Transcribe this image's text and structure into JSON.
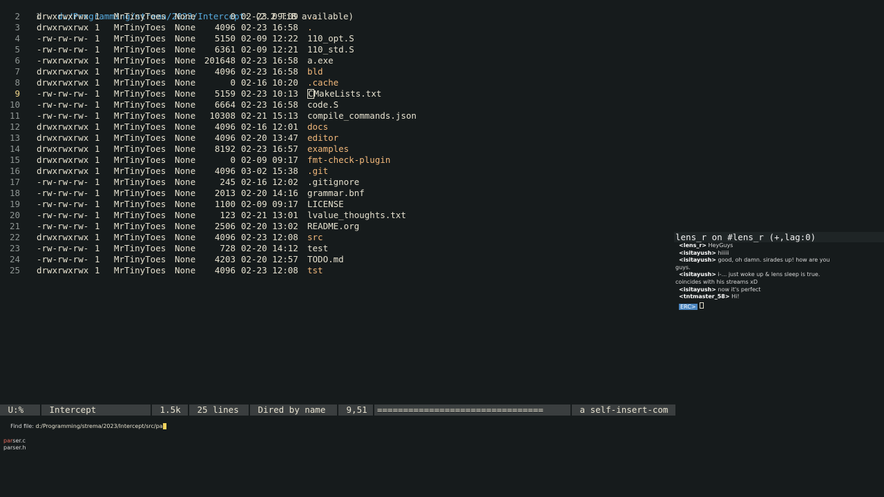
{
  "header_line": {
    "number": "1",
    "path": "d:/Programming/strema/2023/Intercept",
    "suffix": ": (2.2 TiB available)"
  },
  "entries": [
    {
      "n": "2",
      "perms": "drwxrwxrwx",
      "links": "1",
      "owner": "MrTinyToes",
      "group": "None",
      "size": "0",
      "date": "02-23",
      "time": "09:09",
      "name": "..",
      "dir": true
    },
    {
      "n": "3",
      "perms": "drwxrwxrwx",
      "links": "1",
      "owner": "MrTinyToes",
      "group": "None",
      "size": "4096",
      "date": "02-23",
      "time": "16:58",
      "name": ".",
      "dir": true
    },
    {
      "n": "4",
      "perms": "-rw-rw-rw-",
      "links": "1",
      "owner": "MrTinyToes",
      "group": "None",
      "size": "5150",
      "date": "02-09",
      "time": "12:22",
      "name": "110_opt.S",
      "dir": false
    },
    {
      "n": "5",
      "perms": "-rw-rw-rw-",
      "links": "1",
      "owner": "MrTinyToes",
      "group": "None",
      "size": "6361",
      "date": "02-09",
      "time": "12:21",
      "name": "110_std.S",
      "dir": false
    },
    {
      "n": "6",
      "perms": "-rwxrwxrwx",
      "links": "1",
      "owner": "MrTinyToes",
      "group": "None",
      "size": "201648",
      "date": "02-23",
      "time": "16:58",
      "name": "a.exe",
      "dir": false
    },
    {
      "n": "7",
      "perms": "drwxrwxrwx",
      "links": "1",
      "owner": "MrTinyToes",
      "group": "None",
      "size": "4096",
      "date": "02-23",
      "time": "16:58",
      "name": "bld",
      "dir": true
    },
    {
      "n": "8",
      "perms": "drwxrwxrwx",
      "links": "1",
      "owner": "MrTinyToes",
      "group": "None",
      "size": "0",
      "date": "02-16",
      "time": "10:20",
      "name": ".cache",
      "dir": true
    },
    {
      "n": "9",
      "perms": "-rw-rw-rw-",
      "links": "1",
      "owner": "MrTinyToes",
      "group": "None",
      "size": "5159",
      "date": "02-23",
      "time": "10:13",
      "name": "CMakeLists.txt",
      "dir": false,
      "current": true
    },
    {
      "n": "10",
      "perms": "-rw-rw-rw-",
      "links": "1",
      "owner": "MrTinyToes",
      "group": "None",
      "size": "6664",
      "date": "02-23",
      "time": "16:58",
      "name": "code.S",
      "dir": false
    },
    {
      "n": "11",
      "perms": "-rw-rw-rw-",
      "links": "1",
      "owner": "MrTinyToes",
      "group": "None",
      "size": "10308",
      "date": "02-21",
      "time": "15:13",
      "name": "compile_commands.json",
      "dir": false
    },
    {
      "n": "12",
      "perms": "drwxrwxrwx",
      "links": "1",
      "owner": "MrTinyToes",
      "group": "None",
      "size": "4096",
      "date": "02-16",
      "time": "12:01",
      "name": "docs",
      "dir": true
    },
    {
      "n": "13",
      "perms": "drwxrwxrwx",
      "links": "1",
      "owner": "MrTinyToes",
      "group": "None",
      "size": "4096",
      "date": "02-20",
      "time": "13:47",
      "name": "editor",
      "dir": true
    },
    {
      "n": "14",
      "perms": "drwxrwxrwx",
      "links": "1",
      "owner": "MrTinyToes",
      "group": "None",
      "size": "8192",
      "date": "02-23",
      "time": "16:57",
      "name": "examples",
      "dir": true
    },
    {
      "n": "15",
      "perms": "drwxrwxrwx",
      "links": "1",
      "owner": "MrTinyToes",
      "group": "None",
      "size": "0",
      "date": "02-09",
      "time": "09:17",
      "name": "fmt-check-plugin",
      "dir": true
    },
    {
      "n": "16",
      "perms": "drwxrwxrwx",
      "links": "1",
      "owner": "MrTinyToes",
      "group": "None",
      "size": "4096",
      "date": "03-02",
      "time": "15:38",
      "name": ".git",
      "dir": true
    },
    {
      "n": "17",
      "perms": "-rw-rw-rw-",
      "links": "1",
      "owner": "MrTinyToes",
      "group": "None",
      "size": "245",
      "date": "02-16",
      "time": "12:02",
      "name": ".gitignore",
      "dir": false
    },
    {
      "n": "18",
      "perms": "-rw-rw-rw-",
      "links": "1",
      "owner": "MrTinyToes",
      "group": "None",
      "size": "2013",
      "date": "02-20",
      "time": "14:16",
      "name": "grammar.bnf",
      "dir": false
    },
    {
      "n": "19",
      "perms": "-rw-rw-rw-",
      "links": "1",
      "owner": "MrTinyToes",
      "group": "None",
      "size": "1100",
      "date": "02-09",
      "time": "09:17",
      "name": "LICENSE",
      "dir": false
    },
    {
      "n": "20",
      "perms": "-rw-rw-rw-",
      "links": "1",
      "owner": "MrTinyToes",
      "group": "None",
      "size": "123",
      "date": "02-21",
      "time": "13:01",
      "name": "lvalue_thoughts.txt",
      "dir": false
    },
    {
      "n": "21",
      "perms": "-rw-rw-rw-",
      "links": "1",
      "owner": "MrTinyToes",
      "group": "None",
      "size": "2506",
      "date": "02-20",
      "time": "13:02",
      "name": "README.org",
      "dir": false
    },
    {
      "n": "22",
      "perms": "drwxrwxrwx",
      "links": "1",
      "owner": "MrTinyToes",
      "group": "None",
      "size": "4096",
      "date": "02-23",
      "time": "12:08",
      "name": "src",
      "dir": true
    },
    {
      "n": "23",
      "perms": "-rw-rw-rw-",
      "links": "1",
      "owner": "MrTinyToes",
      "group": "None",
      "size": "728",
      "date": "02-20",
      "time": "14:12",
      "name": "test",
      "dir": false
    },
    {
      "n": "24",
      "perms": "-rw-rw-rw-",
      "links": "1",
      "owner": "MrTinyToes",
      "group": "None",
      "size": "4203",
      "date": "02-20",
      "time": "12:57",
      "name": "TODO.md",
      "dir": false
    },
    {
      "n": "25",
      "perms": "drwxrwxrwx",
      "links": "1",
      "owner": "MrTinyToes",
      "group": "None",
      "size": "4096",
      "date": "02-23",
      "time": "12:08",
      "name": "tst",
      "dir": true
    }
  ],
  "irc": {
    "title": "lens_r on #lens_r (+,lag:0)",
    "messages": [
      {
        "nick": "<lens_r>",
        "text": " HeyGuys"
      },
      {
        "nick": "<isitayush>",
        "text": " hiiiii"
      },
      {
        "nick": "<isitayush>",
        "text": " good, oh damn. sirades up! how are you"
      },
      {
        "nick": "",
        "text": "guys."
      },
      {
        "nick": "<isitayush>",
        "text": " i-... just woke up & lens sleep is true."
      },
      {
        "nick": "",
        "text": "coincides with his streams xD"
      },
      {
        "nick": "<isitayush>",
        "text": " now it's perfect"
      },
      {
        "nick": "<tntmaster_58>",
        "text": " Hi!"
      }
    ],
    "prompt": "ERC>"
  },
  "modeline": {
    "state": " U:%",
    "buffer": " Intercept",
    "size": " 1.5k",
    "lines": " 25 lines",
    "mode": " Dired by name",
    "position": " 9,51",
    "progress": "================================",
    "command": " a self-insert-com"
  },
  "minibuffer": {
    "prompt": "Find file: ",
    "input": "d:/Programming/strema/2023/Intercept/src/pa",
    "candidates": [
      {
        "match": "par",
        "rest": "ser.c",
        "selected": true
      },
      {
        "match": "",
        "rest": "parser.h",
        "selected": false
      }
    ]
  },
  "colors": {
    "background": "#161b1c",
    "directory": "#f2b87b",
    "header_path": "#56a9dc",
    "modeline": "#3a3e3f",
    "cursor": "#f2d25c"
  }
}
